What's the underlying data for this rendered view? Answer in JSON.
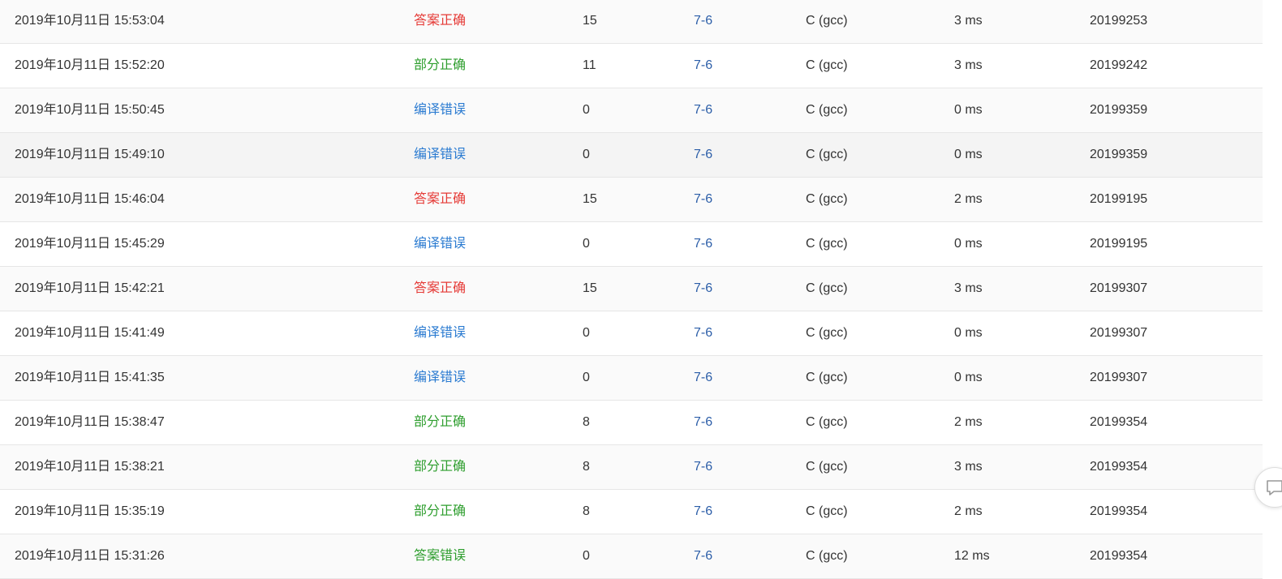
{
  "submissions": [
    {
      "time": "2019年10月11日 15:53:04",
      "status": "答案正确",
      "status_type": "correct",
      "score": "15",
      "problem": "7-6",
      "language": "C (gcc)",
      "memory": "3 ms",
      "user": "20199253"
    },
    {
      "time": "2019年10月11日 15:52:20",
      "status": "部分正确",
      "status_type": "partial",
      "score": "11",
      "problem": "7-6",
      "language": "C (gcc)",
      "memory": "3 ms",
      "user": "20199242"
    },
    {
      "time": "2019年10月11日 15:50:45",
      "status": "编译错误",
      "status_type": "compile",
      "score": "0",
      "problem": "7-6",
      "language": "C (gcc)",
      "memory": "0 ms",
      "user": "20199359"
    },
    {
      "time": "2019年10月11日 15:49:10",
      "status": "编译错误",
      "status_type": "compile",
      "score": "0",
      "problem": "7-6",
      "language": "C (gcc)",
      "memory": "0 ms",
      "user": "20199359"
    },
    {
      "time": "2019年10月11日 15:46:04",
      "status": "答案正确",
      "status_type": "correct",
      "score": "15",
      "problem": "7-6",
      "language": "C (gcc)",
      "memory": "2 ms",
      "user": "20199195"
    },
    {
      "time": "2019年10月11日 15:45:29",
      "status": "编译错误",
      "status_type": "compile",
      "score": "0",
      "problem": "7-6",
      "language": "C (gcc)",
      "memory": "0 ms",
      "user": "20199195"
    },
    {
      "time": "2019年10月11日 15:42:21",
      "status": "答案正确",
      "status_type": "correct",
      "score": "15",
      "problem": "7-6",
      "language": "C (gcc)",
      "memory": "3 ms",
      "user": "20199307"
    },
    {
      "time": "2019年10月11日 15:41:49",
      "status": "编译错误",
      "status_type": "compile",
      "score": "0",
      "problem": "7-6",
      "language": "C (gcc)",
      "memory": "0 ms",
      "user": "20199307"
    },
    {
      "time": "2019年10月11日 15:41:35",
      "status": "编译错误",
      "status_type": "compile",
      "score": "0",
      "problem": "7-6",
      "language": "C (gcc)",
      "memory": "0 ms",
      "user": "20199307"
    },
    {
      "time": "2019年10月11日 15:38:47",
      "status": "部分正确",
      "status_type": "partial",
      "score": "8",
      "problem": "7-6",
      "language": "C (gcc)",
      "memory": "2 ms",
      "user": "20199354"
    },
    {
      "time": "2019年10月11日 15:38:21",
      "status": "部分正确",
      "status_type": "partial",
      "score": "8",
      "problem": "7-6",
      "language": "C (gcc)",
      "memory": "3 ms",
      "user": "20199354"
    },
    {
      "time": "2019年10月11日 15:35:19",
      "status": "部分正确",
      "status_type": "partial",
      "score": "8",
      "problem": "7-6",
      "language": "C (gcc)",
      "memory": "2 ms",
      "user": "20199354"
    },
    {
      "time": "2019年10月11日 15:31:26",
      "status": "答案错误",
      "status_type": "wrong",
      "score": "0",
      "problem": "7-6",
      "language": "C (gcc)",
      "memory": "12 ms",
      "user": "20199354"
    }
  ],
  "colors": {
    "correct": "#e53935",
    "partial": "#2e9e2e",
    "compile": "#2b7bd1",
    "wrong": "#2e9e2e",
    "link": "#2c5ea8"
  },
  "side_widget": {
    "icon": "feedback-icon"
  }
}
